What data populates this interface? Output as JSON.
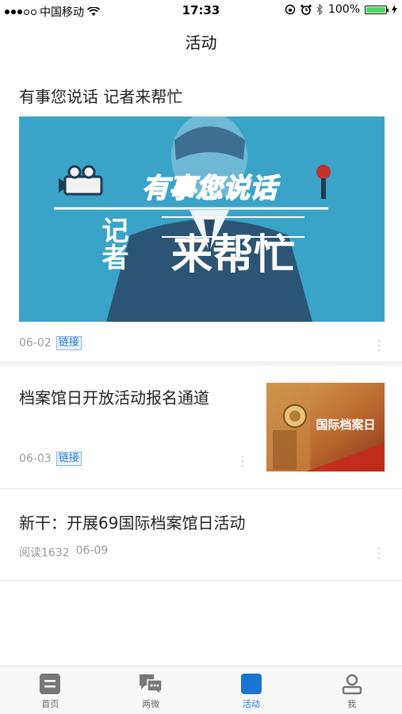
{
  "status_bar": {
    "carrier": "中国移动",
    "time": "17:33",
    "battery": "100%",
    "battery_level": 1.0
  },
  "header": {
    "title": "活动"
  },
  "articles": [
    {
      "title": "有事您说话 记者来帮忙",
      "banner_text_top": "有事您说话",
      "banner_text_left": "记者",
      "banner_text_main": "来帮忙",
      "date": "06-02",
      "badge": "链接"
    },
    {
      "title": "档案馆日开放活动报名通道",
      "thumb_text": "国际档案日",
      "date": "06-03",
      "badge": "链接"
    },
    {
      "title": "新干：开展69国际档案馆日活动",
      "reads": "阅读1632",
      "date": "06-09"
    }
  ],
  "tabs": [
    {
      "label": "首页",
      "icon": "home-doc-icon"
    },
    {
      "label": "两微",
      "icon": "chat-bubbles-icon"
    },
    {
      "label": "活动",
      "icon": "activity-square-icon"
    },
    {
      "label": "我",
      "icon": "user-icon"
    }
  ],
  "colors": {
    "accent": "#1a74d2",
    "banner_bg": "#3aa3c8",
    "badge_text": "#2a7bd3"
  }
}
